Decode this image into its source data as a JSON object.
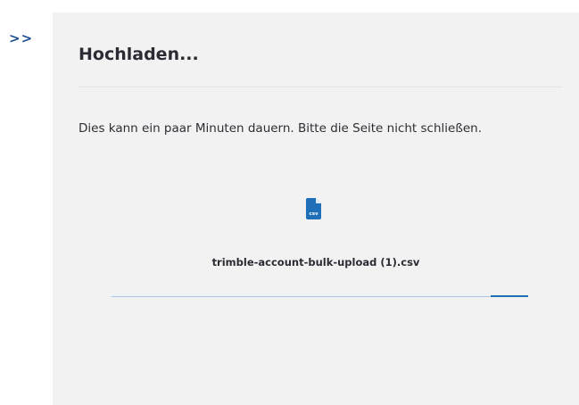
{
  "sidebar": {
    "toggle_label": ">>"
  },
  "upload_dialog": {
    "title": "Hochladen...",
    "message": "Dies kann ein paar Minuten dauern. Bitte die Seite nicht schließen.",
    "file": {
      "icon": "csv-file-icon",
      "icon_label": "csv",
      "name": "trimble-account-bulk-upload (1).csv"
    },
    "progress": {
      "indeterminate_segment_position": 0.91,
      "indeterminate_segment_fraction": 0.09
    }
  },
  "colors": {
    "accent": "#1f6fb8",
    "track": "#a9c8e8",
    "panel_background": "#f2f2f3",
    "toggle": "#1f4f8f"
  }
}
